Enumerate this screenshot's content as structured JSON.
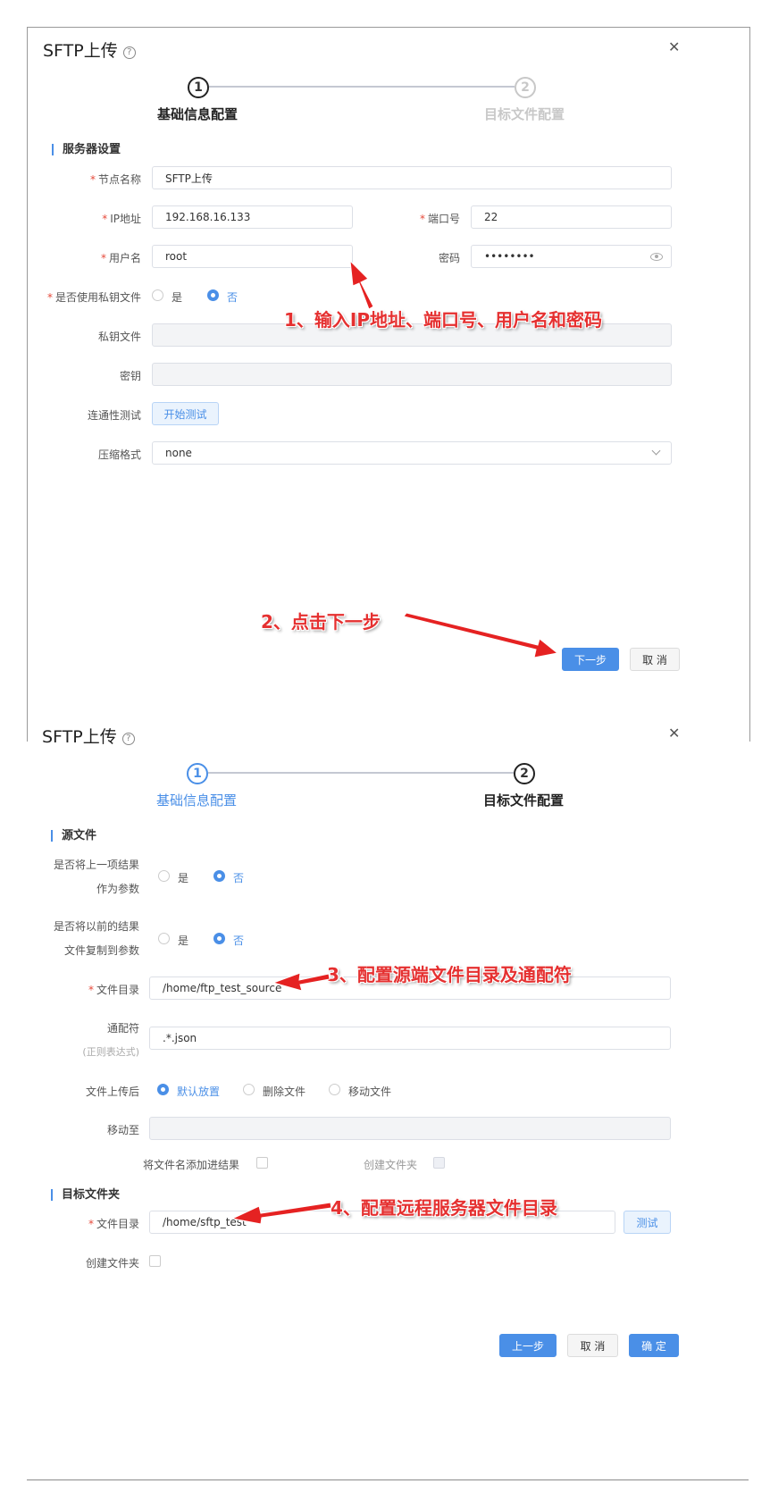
{
  "dialog1": {
    "title": "SFTP上传",
    "help_icon": "question-circle-icon",
    "close_icon": "close-icon",
    "steps": [
      {
        "number": "1",
        "label": "基础信息配置"
      },
      {
        "number": "2",
        "label": "目标文件配置"
      }
    ],
    "section_title": "服务器设置",
    "fields": {
      "node_name": {
        "label": "节点名称",
        "value": "SFTP上传"
      },
      "ip": {
        "label": "IP地址",
        "value": "192.168.16.133"
      },
      "port": {
        "label": "端口号",
        "value": "22"
      },
      "username": {
        "label": "用户名",
        "value": "root"
      },
      "password": {
        "label": "密码",
        "value": "••••••••"
      },
      "use_key": {
        "label": "是否使用私钥文件",
        "options": [
          "是",
          "否"
        ],
        "selected": "否"
      },
      "key_file": {
        "label": "私钥文件",
        "value": ""
      },
      "secret": {
        "label": "密钥",
        "value": ""
      },
      "connectivity": {
        "label": "连通性测试",
        "button": "开始测试"
      },
      "compression": {
        "label": "压缩格式",
        "value": "none"
      }
    },
    "buttons": {
      "next": "下一步",
      "cancel": "取 消"
    },
    "annotations": {
      "note1": "1、输入IP地址、端口号、用户名和密码",
      "note2": "2、点击下一步"
    }
  },
  "dialog2": {
    "title": "SFTP上传",
    "steps": [
      {
        "number": "1",
        "label": "基础信息配置"
      },
      {
        "number": "2",
        "label": "目标文件配置"
      }
    ],
    "source_section": "源文件",
    "fields": {
      "prev_result": {
        "label_line1": "是否将上一项结果",
        "label_line2": "作为参数",
        "options": [
          "是",
          "否"
        ],
        "selected": "否"
      },
      "copy_prev": {
        "label_line1": "是否将以前的结果",
        "label_line2": "文件复制到参数",
        "options": [
          "是",
          "否"
        ],
        "selected": "否"
      },
      "file_dir": {
        "label": "文件目录",
        "value": "/home/ftp_test_source"
      },
      "wildcard": {
        "label": "通配符",
        "sublabel": "(正则表达式)",
        "value": ".*.json"
      },
      "after_upload": {
        "label": "文件上传后",
        "options": [
          "默认放置",
          "删除文件",
          "移动文件"
        ],
        "selected": "默认放置"
      },
      "move_to": {
        "label": "移动至",
        "value": ""
      },
      "add_filename": {
        "label": "将文件名添加进结果"
      },
      "create_folder_src": {
        "label": "创建文件夹"
      }
    },
    "target_section": "目标文件夹",
    "target": {
      "file_dir": {
        "label": "文件目录",
        "value": "/home/sftp_test",
        "button": "测试"
      },
      "create_folder": {
        "label": "创建文件夹"
      }
    },
    "buttons": {
      "prev": "上一步",
      "cancel": "取 消",
      "ok": "确 定"
    },
    "annotations": {
      "note3": "3、配置源端文件目录及通配符",
      "note4": "4、配置远程服务器文件目录"
    }
  },
  "colors": {
    "accent": "#4a8fe7",
    "required": "#e64a3b",
    "annotation": "#e53030"
  }
}
